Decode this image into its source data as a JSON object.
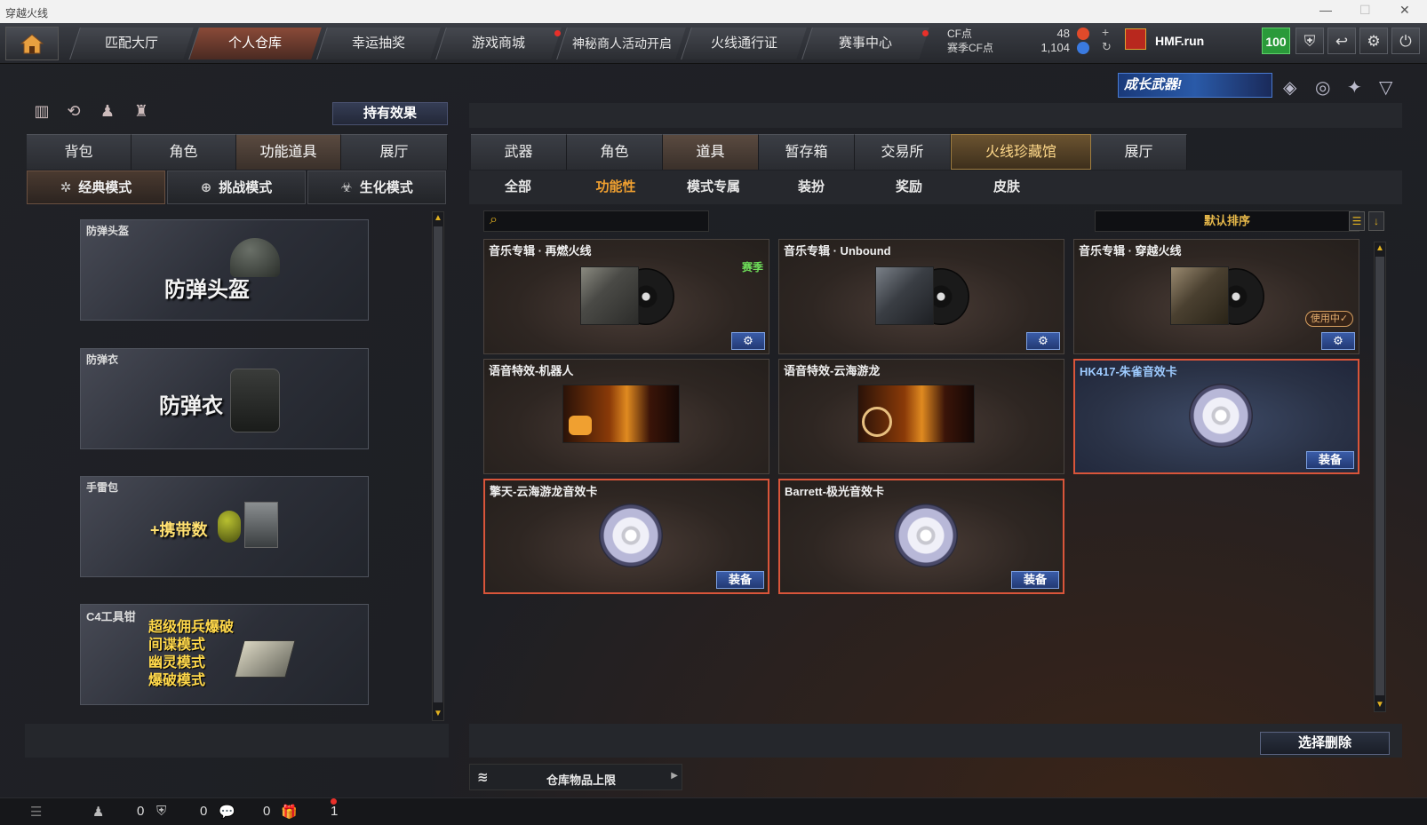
{
  "window": {
    "title": "穿越火线"
  },
  "nav": {
    "tabs": [
      {
        "label": "匹配大厅"
      },
      {
        "label": "个人仓库"
      },
      {
        "label": "幸运抽奖"
      },
      {
        "label": "游戏商城"
      },
      {
        "label": "神秘商人活动开启"
      },
      {
        "label": "火线通行证"
      },
      {
        "label": "赛事中心"
      }
    ],
    "cf_label": "CF点",
    "season_cf_label": "赛季CF点",
    "cf_value": "48",
    "season_cf_value": "1,104",
    "username": "HMF.run",
    "level": "100"
  },
  "banner": {
    "text": "成长武器!"
  },
  "left": {
    "effect_button": "持有效果",
    "tabs": [
      {
        "label": "背包"
      },
      {
        "label": "角色"
      },
      {
        "label": "功能道具"
      },
      {
        "label": "展厅"
      }
    ],
    "modes": [
      {
        "label": "经典模式"
      },
      {
        "label": "挑战模式"
      },
      {
        "label": "生化模式"
      }
    ],
    "cards": [
      {
        "label": "防弹头盔",
        "big": "防弹头盔"
      },
      {
        "label": "防弹衣",
        "big": "防弹衣"
      },
      {
        "label": "手雷包",
        "big": "+携带数"
      },
      {
        "label": "C4工具钳",
        "lines": [
          "超级佣兵爆破",
          "间谍模式",
          "幽灵模式",
          "爆破模式"
        ]
      }
    ]
  },
  "right": {
    "tabs": [
      {
        "label": "武器"
      },
      {
        "label": "角色"
      },
      {
        "label": "道具"
      },
      {
        "label": "暂存箱"
      },
      {
        "label": "交易所"
      },
      {
        "label": "火线珍藏馆"
      },
      {
        "label": "展厅"
      }
    ],
    "subtabs": [
      {
        "label": "全部"
      },
      {
        "label": "功能性"
      },
      {
        "label": "模式专属"
      },
      {
        "label": "装扮"
      },
      {
        "label": "奖励"
      },
      {
        "label": "皮肤"
      }
    ],
    "search_placeholder": "",
    "sort_label": "默认排序",
    "items": [
      {
        "title": "音乐专辑 · 再燃火线",
        "tag": "赛季"
      },
      {
        "title": "音乐专辑 · Unbound"
      },
      {
        "title": "音乐专辑 · 穿越火线",
        "status": "使用中✓"
      },
      {
        "title": "语音特效-机器人"
      },
      {
        "title": "语音特效-云海游龙"
      },
      {
        "title": "HK417-朱雀音效卡",
        "button": "装备"
      },
      {
        "title": "擎天-云海游龙音效卡",
        "button": "装备"
      },
      {
        "title": "Barrett-极光音效卡",
        "button": "装备"
      }
    ],
    "delete_button": "选择删除",
    "capacity_label": "仓库物品上限"
  },
  "bottom": {
    "count1": "0",
    "count2": "0",
    "count3": "0",
    "count4": "1"
  },
  "colors": {
    "accent": "#f0a030",
    "selected_border": "#d9553a",
    "level_bg": "#2a9a3a"
  }
}
